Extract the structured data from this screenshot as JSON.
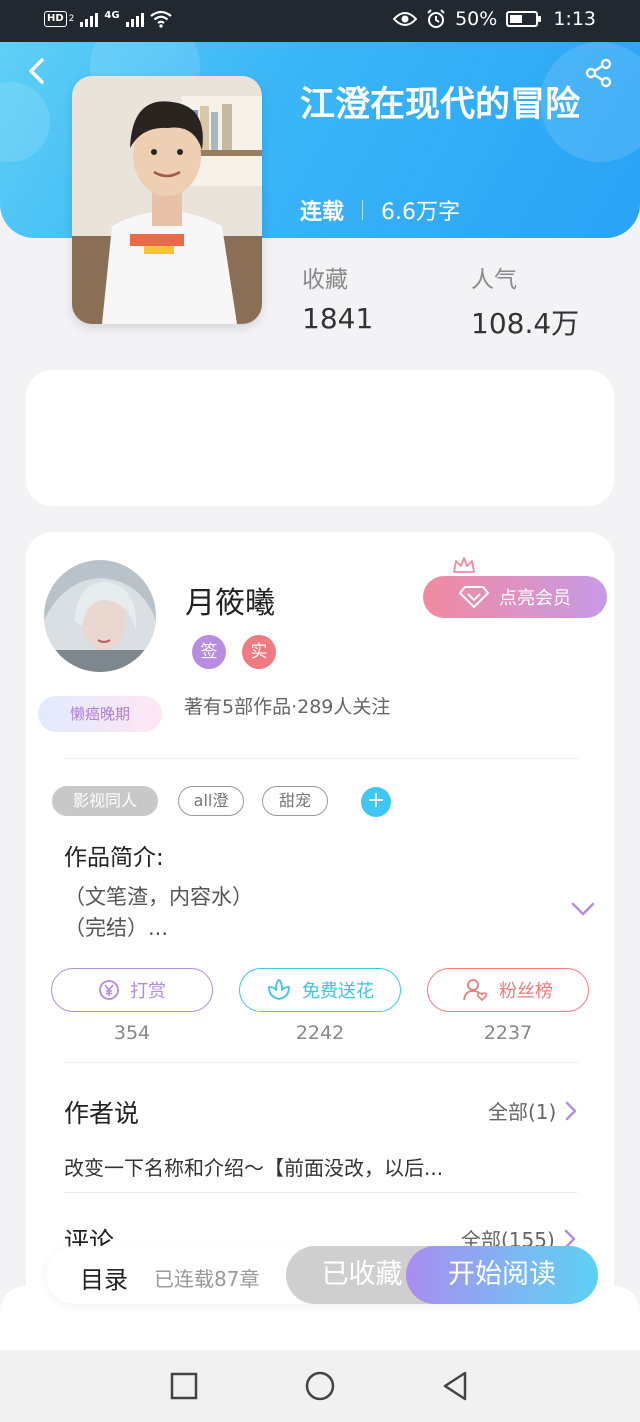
{
  "status_bar": {
    "hd": "HD",
    "hd_sub": "2",
    "network": "4G",
    "battery": "50%",
    "time": "1:13"
  },
  "book": {
    "title": "江澄在现代的冒险",
    "status": "连载",
    "word_count": "6.6万字",
    "favorites_label": "收藏",
    "favorites_value": "1841",
    "popularity_label": "人气",
    "popularity_value": "108.4万"
  },
  "author": {
    "name": "月筱曦",
    "badge_sign": "签",
    "badge_real": "实",
    "stats": "著有5部作品·289人关注",
    "status_badge": "懒癌晚期",
    "vip_label": "点亮会员"
  },
  "tags": [
    "影视同人",
    "all澄",
    "甜宠"
  ],
  "intro": {
    "heading": "作品简介:",
    "line1": "（文笔渣，内容水）",
    "line2": "（完结）..."
  },
  "actions": [
    {
      "label": "打赏",
      "count": "354",
      "color": "#b38be0"
    },
    {
      "label": "免费送花",
      "count": "2242",
      "color": "#3cc5e6"
    },
    {
      "label": "粉丝榜",
      "count": "2237",
      "color": "#ef7b7b"
    }
  ],
  "author_says": {
    "heading": "作者说",
    "all_label": "全部(1)",
    "text": "改变一下名称和介绍～【前面没改，以后..."
  },
  "comments": {
    "heading": "评论",
    "all_label": "全部(155)"
  },
  "bottom_bar": {
    "toc_label": "目录",
    "chapters": "已连载87章",
    "favorited_label": "已收藏",
    "read_label": "开始阅读"
  },
  "icons": {
    "back": "back-arrow-icon",
    "share": "share-icon",
    "expand": "chevron-down-icon",
    "more": "chevron-right-icon"
  },
  "colors": {
    "header_start": "#5fd0f5",
    "header_end": "#2aa3f6",
    "accent_cyan": "#3fc6f3",
    "accent_purple": "#b38be0",
    "accent_red": "#ef7b7b"
  }
}
